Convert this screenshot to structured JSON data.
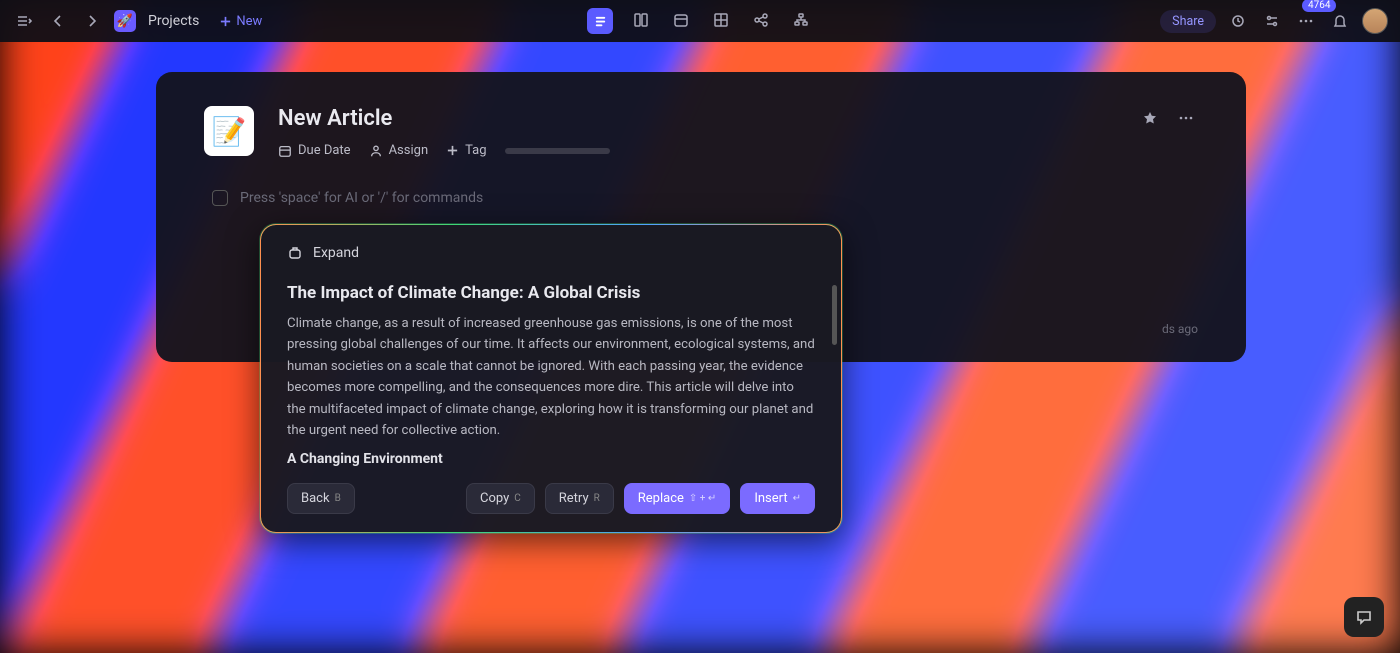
{
  "topbar": {
    "breadcrumb": "Projects",
    "new_label": "New",
    "share_label": "Share",
    "credit_count": "4764"
  },
  "article": {
    "title": "New Article",
    "meta": {
      "due_date": "Due Date",
      "assign": "Assign",
      "tag": "Tag"
    },
    "editor_placeholder": "Press 'space' for AI or '/' for commands",
    "timestamp_suffix": "ds ago"
  },
  "ai_popup": {
    "expand_label": "Expand",
    "heading": "The Impact of Climate Change: A Global Crisis",
    "paragraph": "Climate change, as a result of increased greenhouse gas emissions, is one of the most pressing global challenges of our time. It affects our environment, ecological systems, and human societies on a scale that cannot be ignored. With each passing year, the evidence becomes more compelling, and the consequences more dire. This article will delve into the multifaceted impact of climate change, exploring how it is transforming our planet and the urgent need for collective action.",
    "subheading": "A Changing Environment",
    "buttons": {
      "back": "Back",
      "back_key": "B",
      "copy": "Copy",
      "copy_key": "C",
      "retry": "Retry",
      "retry_key": "R",
      "replace": "Replace",
      "replace_key": "⇧ + ↵",
      "insert": "Insert",
      "insert_key": "↵"
    }
  }
}
